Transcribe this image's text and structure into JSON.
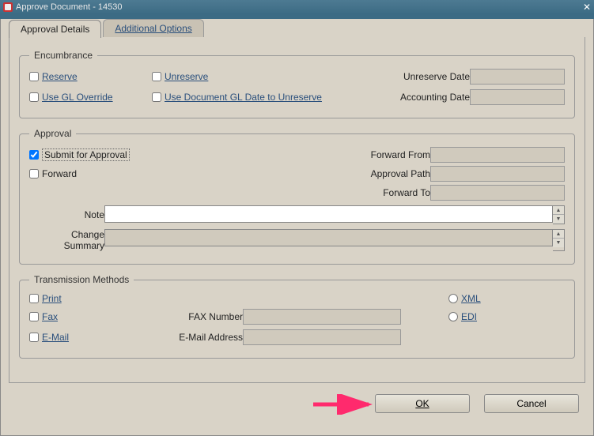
{
  "window": {
    "title": "Approve Document - 14530"
  },
  "tabs": {
    "approval_details": "Approval Details",
    "additional_options": "Additional Options"
  },
  "encumbrance": {
    "legend": "Encumbrance",
    "reserve": "Reserve",
    "unreserve": "Unreserve",
    "use_gl_override": "Use GL Override",
    "use_doc_gl_date": "Use Document GL Date to Unreserve",
    "unreserve_date_label": "Unreserve Date",
    "unreserve_date_value": "",
    "accounting_date_label": "Accounting Date",
    "accounting_date_value": ""
  },
  "approval": {
    "legend": "Approval",
    "submit_for_approval": "Submit for Approval",
    "forward": "Forward",
    "forward_from_label": "Forward From",
    "forward_from_value": "",
    "approval_path_label": "Approval Path",
    "approval_path_value": "",
    "forward_to_label": "Forward To",
    "forward_to_value": "",
    "note_label": "Note",
    "note_value": "",
    "change_summary_label": "Change Summary",
    "change_summary_value": ""
  },
  "transmission": {
    "legend": "Transmission Methods",
    "print": "Print",
    "fax": "Fax",
    "email": "E-Mail",
    "fax_number_label": "FAX Number",
    "fax_number_value": "",
    "email_address_label": "E-Mail Address",
    "email_address_value": "",
    "xml": "XML",
    "edi": "EDI"
  },
  "buttons": {
    "ok": "OK",
    "cancel": "Cancel"
  }
}
